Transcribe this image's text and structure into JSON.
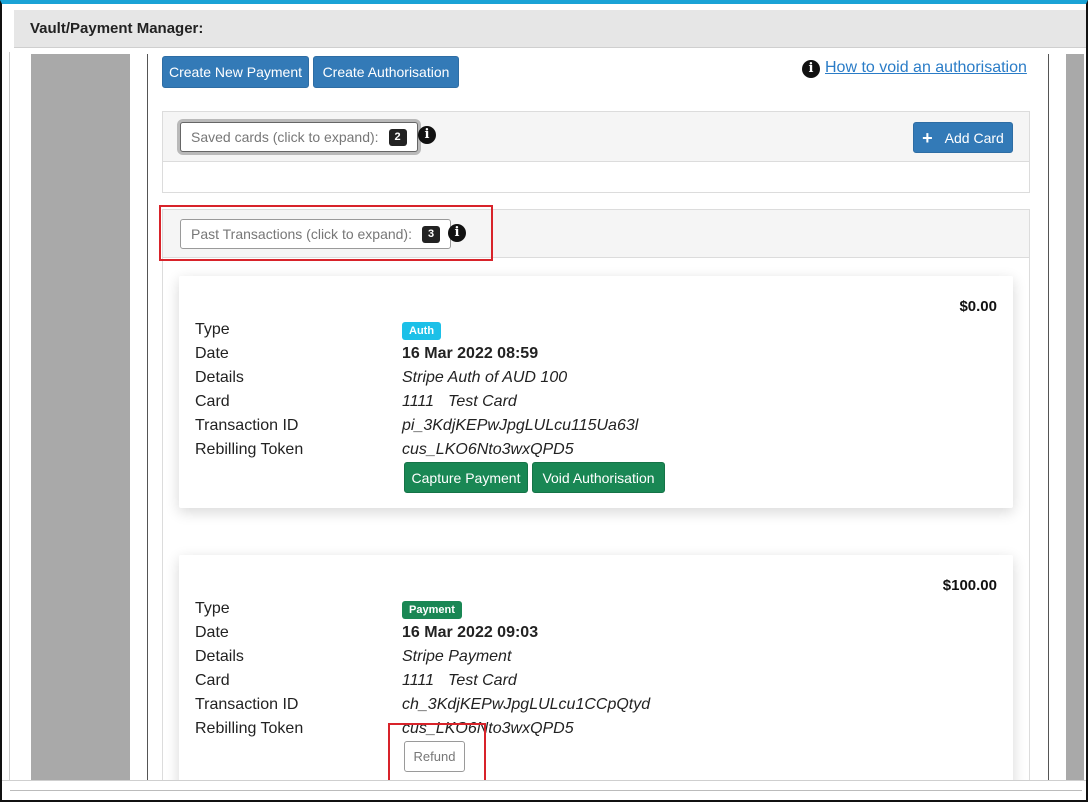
{
  "window": {
    "title": "Vault/Payment Manager:"
  },
  "toolbar": {
    "create_payment_label": "Create New Payment",
    "create_auth_label": "Create Authorisation",
    "help_link": "How to void an authorisation"
  },
  "saved_cards": {
    "expand_label": "Saved cards (click to expand):",
    "count": "2",
    "add_label": "Add Card"
  },
  "transactions": {
    "expand_label": "Past Transactions (click to expand):",
    "count": "3",
    "labels": {
      "type": "Type",
      "date": "Date",
      "details": "Details",
      "card": "Card",
      "txn_id": "Transaction ID",
      "token": "Rebilling Token"
    },
    "items": [
      {
        "amount": "$0.00",
        "type": "Auth",
        "date": "16 Mar 2022 08:59",
        "details": "Stripe Auth of AUD 100",
        "card_last4": "1111",
        "card_name": "Test Card",
        "txn_id": "pi_3KdjKEPwJpgLULcu115Ua63l",
        "token": "cus_LKO6Nto3wxQPD5",
        "actions": [
          "Capture Payment",
          "Void Authorisation"
        ]
      },
      {
        "amount": "$100.00",
        "type": "Payment",
        "date": "16 Mar 2022 09:03",
        "details": "Stripe Payment",
        "card_last4": "1111",
        "card_name": "Test Card",
        "txn_id": "ch_3KdjKEPwJpgLULcu1CCpQtyd",
        "token": "cus_LKO6Nto3wxQPD5",
        "actions": [
          "Refund"
        ]
      }
    ]
  },
  "colors": {
    "primary": "#337ab7",
    "success": "#198754",
    "info": "#1cc0e8",
    "highlight": "#d8232a",
    "window_accent": "#1aa3d6"
  }
}
